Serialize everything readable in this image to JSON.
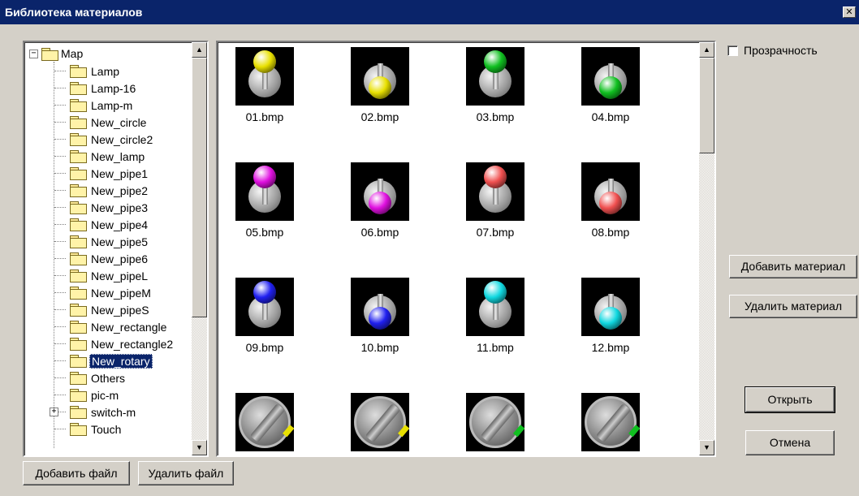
{
  "window": {
    "title": "Библиотека материалов",
    "close_glyph": "✕"
  },
  "tree": {
    "root": {
      "label": "Map",
      "expander": "−"
    },
    "items": [
      {
        "label": "Lamp"
      },
      {
        "label": "Lamp-16"
      },
      {
        "label": "Lamp-m"
      },
      {
        "label": "New_circle"
      },
      {
        "label": "New_circle2"
      },
      {
        "label": "New_lamp"
      },
      {
        "label": "New_pipe1"
      },
      {
        "label": "New_pipe2"
      },
      {
        "label": "New_pipe3"
      },
      {
        "label": "New_pipe4"
      },
      {
        "label": "New_pipe5"
      },
      {
        "label": "New_pipe6"
      },
      {
        "label": "New_pipeL"
      },
      {
        "label": "New_pipeM"
      },
      {
        "label": "New_pipeS"
      },
      {
        "label": "New_rectangle"
      },
      {
        "label": "New_rectangle2"
      },
      {
        "label": "New_rotary",
        "selected": true
      },
      {
        "label": "Others"
      },
      {
        "label": "pic-m"
      },
      {
        "label": "switch-m",
        "expander": "+"
      },
      {
        "label": "Touch"
      }
    ]
  },
  "gallery": {
    "files": [
      {
        "name": "01.bmp",
        "kind": "toggle",
        "position": "top",
        "color": "#e8e000"
      },
      {
        "name": "02.bmp",
        "kind": "toggle",
        "position": "bottom",
        "color": "#e8e000"
      },
      {
        "name": "03.bmp",
        "kind": "toggle",
        "position": "top",
        "color": "#10c020"
      },
      {
        "name": "04.bmp",
        "kind": "toggle",
        "position": "bottom",
        "color": "#10c020"
      },
      {
        "name": "05.bmp",
        "kind": "toggle",
        "position": "top",
        "color": "#e010e0"
      },
      {
        "name": "06.bmp",
        "kind": "toggle",
        "position": "bottom",
        "color": "#e010e0"
      },
      {
        "name": "07.bmp",
        "kind": "toggle",
        "position": "top",
        "color": "#f05050"
      },
      {
        "name": "08.bmp",
        "kind": "toggle",
        "position": "bottom",
        "color": "#f05050"
      },
      {
        "name": "09.bmp",
        "kind": "toggle",
        "position": "top",
        "color": "#2020f0"
      },
      {
        "name": "10.bmp",
        "kind": "toggle",
        "position": "bottom",
        "color": "#2020f0"
      },
      {
        "name": "11.bmp",
        "kind": "toggle",
        "position": "top",
        "color": "#10d8e0"
      },
      {
        "name": "12.bmp",
        "kind": "toggle",
        "position": "bottom",
        "color": "#10d8e0"
      },
      {
        "name": "",
        "kind": "rotary",
        "color": "#e8e000"
      },
      {
        "name": "",
        "kind": "rotary",
        "color": "#e8e000"
      },
      {
        "name": "",
        "kind": "rotary",
        "color": "#10c020"
      },
      {
        "name": "",
        "kind": "rotary",
        "color": "#10c020"
      }
    ]
  },
  "options": {
    "transparency_label": "Прозрачность",
    "transparency_checked": false
  },
  "buttons": {
    "add_material": "Добавить материал",
    "delete_material": "Удалить материал",
    "open": "Открыть",
    "cancel": "Отмена",
    "add_file": "Добавить файл",
    "delete_file": "Удалить файл"
  },
  "scroll_glyphs": {
    "up": "▲",
    "down": "▼"
  }
}
